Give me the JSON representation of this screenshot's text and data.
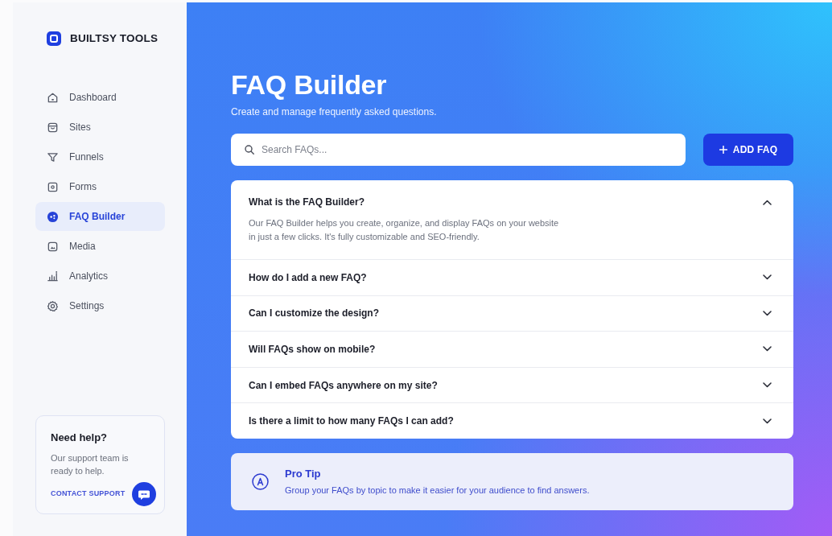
{
  "sidebar": {
    "brand": "BUILTSY TOOLS",
    "items": [
      {
        "label": "Dashboard",
        "selected": false
      },
      {
        "label": "Sites",
        "selected": false
      },
      {
        "label": "Funnels",
        "selected": false
      },
      {
        "label": "Forms",
        "selected": false
      },
      {
        "label": "FAQ Builder",
        "selected": true
      },
      {
        "label": "Media",
        "selected": false
      },
      {
        "label": "Analytics",
        "selected": false
      },
      {
        "label": "Settings",
        "selected": false
      }
    ],
    "help": {
      "title": "Need help?",
      "text": "Our support team is ready to help.",
      "link": "CONTACT SUPPORT"
    }
  },
  "header": {
    "title": "FAQ Builder",
    "subtitle": "Create and manage frequently asked questions."
  },
  "search": {
    "placeholder": "Search FAQs..."
  },
  "add_button": "ADD FAQ",
  "faqs": [
    {
      "question": "What is the FAQ Builder?",
      "expanded": true,
      "answer": "Our FAQ Builder helps you create, organize, and display FAQs on your website in just a few clicks. It's fully customizable and SEO-friendly."
    },
    {
      "question": "How do I add a new FAQ?",
      "expanded": false
    },
    {
      "question": "Can I customize the design?",
      "expanded": false
    },
    {
      "question": "Will FAQs show on mobile?",
      "expanded": false
    },
    {
      "question": "Can I embed FAQs anywhere on my site?",
      "expanded": false
    },
    {
      "question": "Is there a limit to how many FAQs I can add?",
      "expanded": false
    }
  ],
  "tip": {
    "title": "Pro Tip",
    "text": "Group your FAQs by topic to make it easier for your audience to find answers."
  }
}
